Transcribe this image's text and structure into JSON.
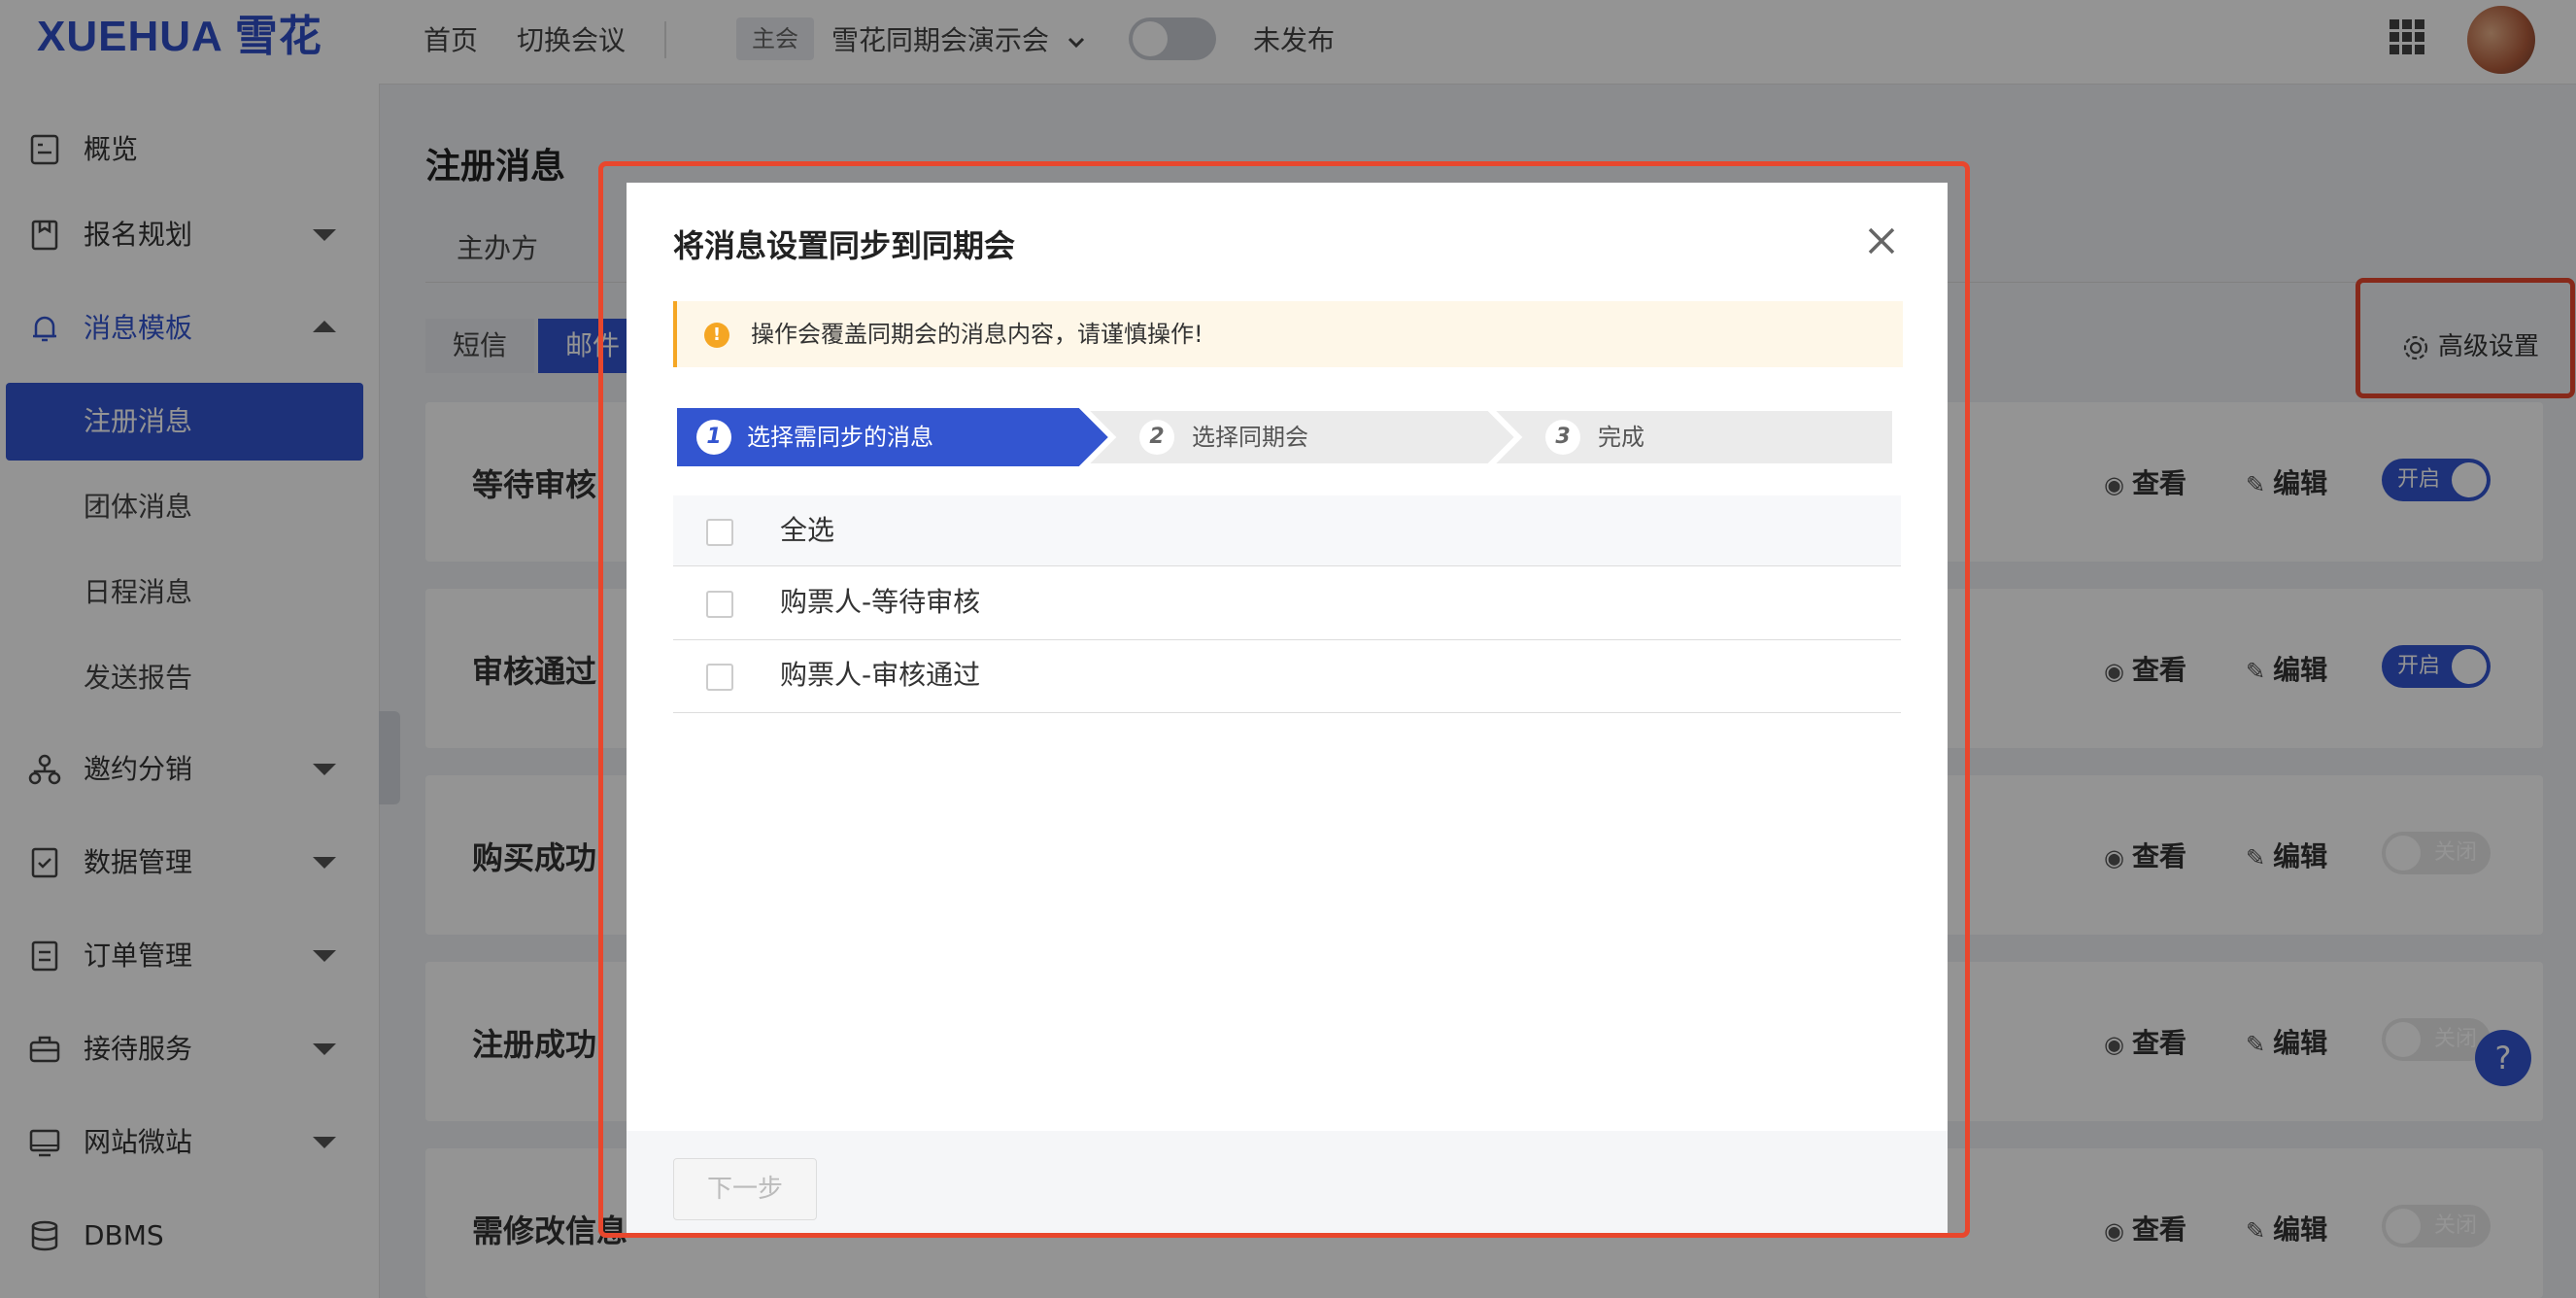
{
  "header": {
    "logo_en": "XUEHUA",
    "logo_cn": "雪花",
    "nav_home": "首页",
    "nav_switch": "切换会议",
    "main_tag": "主会",
    "meeting_name": "雪花同期会演示会",
    "publish_status": "未发布"
  },
  "sidebar": {
    "items": [
      {
        "label": "概览",
        "icon": "overview-icon"
      },
      {
        "label": "报名规划",
        "icon": "registration-icon"
      },
      {
        "label": "消息模板",
        "icon": "bell-icon"
      },
      {
        "label": "邀约分销",
        "icon": "distribution-icon"
      },
      {
        "label": "数据管理",
        "icon": "data-icon"
      },
      {
        "label": "订单管理",
        "icon": "order-icon"
      },
      {
        "label": "接待服务",
        "icon": "reception-icon"
      },
      {
        "label": "网站微站",
        "icon": "website-icon"
      },
      {
        "label": "DBMS",
        "icon": "database-icon"
      }
    ],
    "sub_items": [
      "注册消息",
      "团体消息",
      "日程消息",
      "发送报告"
    ]
  },
  "content": {
    "title": "注册消息",
    "tab_organizer": "主办方",
    "seg_sms": "短信",
    "seg_mail": "邮件",
    "advanced_settings": "高级设置",
    "view_label": "查看",
    "edit_label": "编辑",
    "on_label": "开启",
    "off_label": "关闭",
    "cards": [
      {
        "title": "等待审核",
        "enabled": true
      },
      {
        "title": "审核通过",
        "enabled": true
      },
      {
        "title": "购买成功",
        "enabled": false
      },
      {
        "title": "注册成功",
        "enabled": false
      },
      {
        "title": "需修改信息",
        "enabled": false
      }
    ]
  },
  "help": "?",
  "modal": {
    "title": "将消息设置同步到同期会",
    "warning": "操作会覆盖同期会的消息内容，请谨慎操作!",
    "steps": [
      {
        "num": "1",
        "label": "选择需同步的消息"
      },
      {
        "num": "2",
        "label": "选择同期会"
      },
      {
        "num": "3",
        "label": "完成"
      }
    ],
    "select_all": "全选",
    "rows": [
      "购票人-等待审核",
      "购票人-审核通过"
    ],
    "next_button": "下一步"
  },
  "colors": {
    "brand": "#3355d0",
    "highlight": "#e8472d",
    "warning": "#f5a623"
  }
}
